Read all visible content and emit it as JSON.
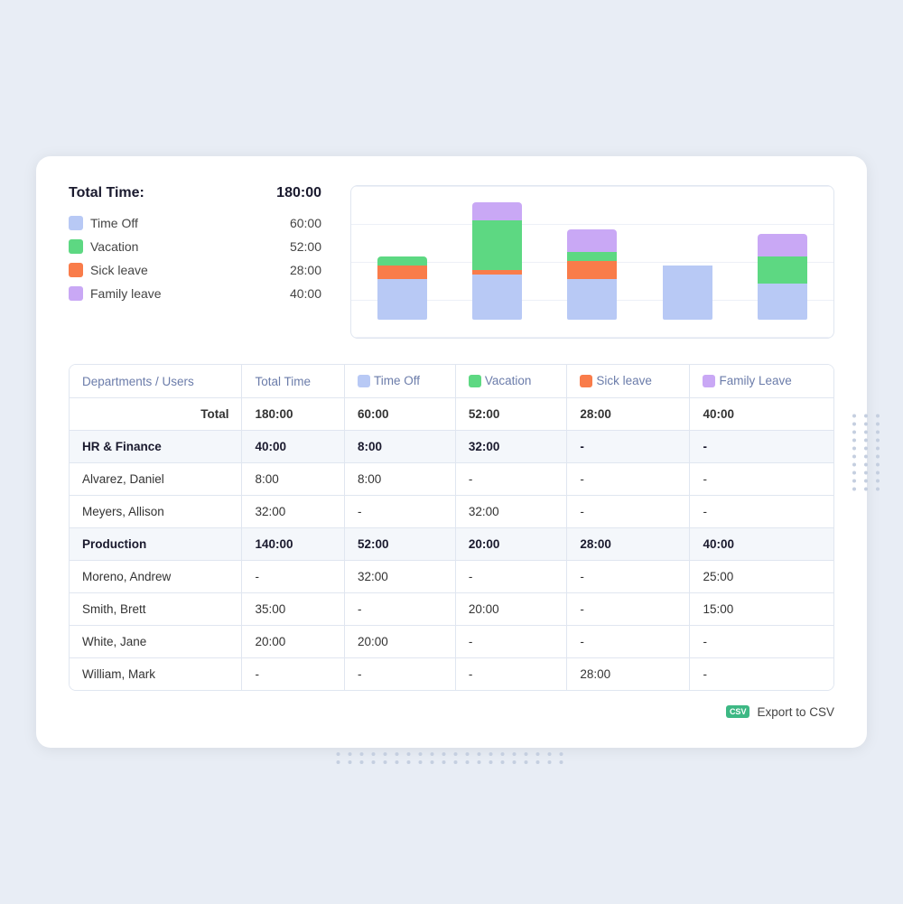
{
  "summary": {
    "total_label": "Total Time:",
    "total_value": "180:00",
    "legend": [
      {
        "label": "Time Off",
        "value": "60:00",
        "color": "#b8c9f5"
      },
      {
        "label": "Vacation",
        "value": "52:00",
        "color": "#5dd882"
      },
      {
        "label": "Sick leave",
        "value": "28:00",
        "color": "#f97c4a"
      },
      {
        "label": "Family leave",
        "value": "40:00",
        "color": "#c9a8f5"
      }
    ]
  },
  "chart": {
    "bars": [
      {
        "timeoff": 45,
        "vacation": 10,
        "sick": 15,
        "family": 0
      },
      {
        "timeoff": 50,
        "vacation": 55,
        "sick": 5,
        "family": 20
      },
      {
        "timeoff": 45,
        "vacation": 10,
        "sick": 20,
        "family": 25
      },
      {
        "timeoff": 60,
        "vacation": 0,
        "sick": 0,
        "family": 0
      },
      {
        "timeoff": 40,
        "vacation": 30,
        "sick": 0,
        "family": 25
      }
    ]
  },
  "table": {
    "columns": [
      "Departments / Users",
      "Total Time",
      "Time Off",
      "Vacation",
      "Sick leave",
      "Family Leave"
    ],
    "total_row": [
      "Total",
      "180:00",
      "60:00",
      "52:00",
      "28:00",
      "40:00"
    ],
    "departments": [
      {
        "name": "HR & Finance",
        "total": "40:00",
        "timeoff": "8:00",
        "vacation": "32:00",
        "sick": "-",
        "family": "-",
        "users": [
          {
            "name": "Alvarez, Daniel",
            "total": "8:00",
            "timeoff": "8:00",
            "vacation": "-",
            "sick": "-",
            "family": "-"
          },
          {
            "name": "Meyers, Allison",
            "total": "32:00",
            "timeoff": "-",
            "vacation": "32:00",
            "sick": "-",
            "family": "-"
          }
        ]
      },
      {
        "name": "Production",
        "total": "140:00",
        "timeoff": "52:00",
        "vacation": "20:00",
        "sick": "28:00",
        "family": "40:00",
        "users": [
          {
            "name": "Moreno, Andrew",
            "total": "-",
            "timeoff": "32:00",
            "vacation": "-",
            "sick": "-",
            "family": "25:00"
          },
          {
            "name": "Smith, Brett",
            "total": "35:00",
            "timeoff": "-",
            "vacation": "20:00",
            "sick": "-",
            "family": "15:00"
          },
          {
            "name": "White, Jane",
            "total": "20:00",
            "timeoff": "20:00",
            "vacation": "-",
            "sick": "-",
            "family": "-"
          },
          {
            "name": "William, Mark",
            "total": "-",
            "timeoff": "-",
            "vacation": "-",
            "sick": "28:00",
            "family": "-"
          }
        ]
      }
    ]
  },
  "footer": {
    "export_label": "Export to CSV",
    "csv_badge": "CSV"
  },
  "colors": {
    "timeoff": "#b8c9f5",
    "vacation": "#5dd882",
    "sick": "#f97c4a",
    "family": "#c9a8f5"
  }
}
